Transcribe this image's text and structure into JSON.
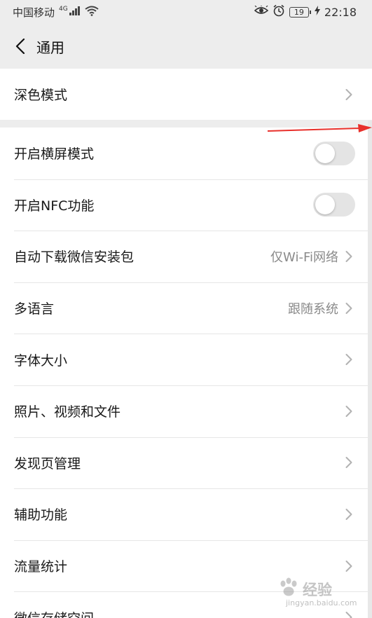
{
  "status_bar": {
    "carrier": "中国移动",
    "network": "4G",
    "battery": "19",
    "time": "22:18"
  },
  "nav": {
    "title": "通用"
  },
  "groups": {
    "first": {
      "dark_mode": "深色模式"
    },
    "second": {
      "landscape": {
        "label": "开启横屏模式",
        "on": false
      },
      "nfc": {
        "label": "开启NFC功能",
        "on": false
      },
      "auto_download": {
        "label": "自动下载微信安装包",
        "value": "仅Wi-Fi网络"
      },
      "language": {
        "label": "多语言",
        "value": "跟随系统"
      },
      "font_size": {
        "label": "字体大小"
      },
      "media": {
        "label": "照片、视频和文件"
      },
      "discover": {
        "label": "发现页管理"
      },
      "accessibility": {
        "label": "辅助功能"
      },
      "traffic": {
        "label": "流量统计"
      },
      "storage": {
        "label": "微信存储空间"
      }
    }
  },
  "watermark": {
    "brand": "经验",
    "site": "jingyan.baidu.com"
  },
  "colors": {
    "background": "#ededed",
    "row": "#ffffff",
    "toggle_off": "#e4e4e4",
    "annotation_arrow": "#e8302b"
  },
  "icons": [
    "back-arrow-icon",
    "chevron-right-icon",
    "eye-icon",
    "alarm-icon",
    "signal-icon",
    "wifi-icon",
    "battery-icon",
    "charging-icon"
  ]
}
